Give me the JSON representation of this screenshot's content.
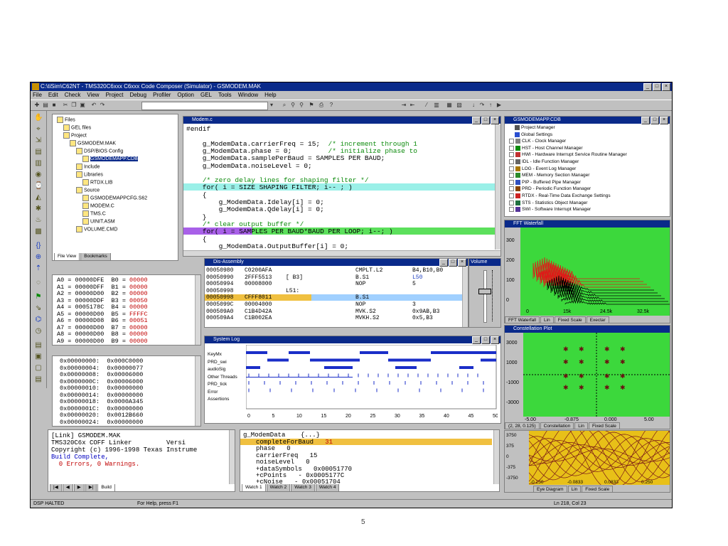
{
  "window": {
    "title": "C:\\tiSim\\C62NT - TMS320C6xxx C6xxx Code Composer (Simulator) - GSMODEM.MAK",
    "menu": [
      "File",
      "Edit",
      "Check",
      "View",
      "Project",
      "Debug",
      "Profiler",
      "Option",
      "GEL",
      "Tools",
      "Window",
      "Help"
    ]
  },
  "project_tree": {
    "items": [
      {
        "label": "Files",
        "level": 0
      },
      {
        "label": "GEL files",
        "level": 1
      },
      {
        "label": "Project",
        "level": 1
      },
      {
        "label": "GSMODEM.MAK",
        "level": 2
      },
      {
        "label": "DSP/BIOS Config",
        "level": 3
      },
      {
        "label": "GSMODEMAPP.CDB",
        "level": 4,
        "selected": true
      },
      {
        "label": "Include",
        "level": 3
      },
      {
        "label": "Libraries",
        "level": 3
      },
      {
        "label": "RTDX.LIB",
        "level": 4
      },
      {
        "label": "Source",
        "level": 3
      },
      {
        "label": "GSMODEMAPPCFG.S62",
        "level": 4
      },
      {
        "label": "MODEM.C",
        "level": 4
      },
      {
        "label": "TMS.C",
        "level": 4
      },
      {
        "label": "UINIT.ASM",
        "level": 4
      },
      {
        "label": "VOLUME.CMD",
        "level": 3
      }
    ],
    "tabs": [
      "File View",
      "Bookmarks"
    ]
  },
  "editor": {
    "title": "Modem.c",
    "lines": [
      {
        "text": "#endif",
        "style": "normal"
      },
      {
        "text": "",
        "style": "normal"
      },
      {
        "text": "    g_ModemData.carrierFreq = 15;  ",
        "comment": "/* increment through 1",
        "style": "normal"
      },
      {
        "text": "    g_ModemData.phase = 0;         ",
        "comment": "/* initialize phase to",
        "style": "normal"
      },
      {
        "text": "    g_ModemData.samplePerBaud = SAMPLES PER BAUD;",
        "style": "normal"
      },
      {
        "text": "    g_ModemData.noiseLevel = 0;",
        "style": "normal"
      },
      {
        "text": "",
        "style": "normal"
      },
      {
        "text": "    ",
        "comment": "/* zero delay lines for shaping filter */",
        "style": "normal"
      },
      {
        "text": "    for( i = SIZE SHAPING FILTER; i-- ; )",
        "style": "cyan"
      },
      {
        "text": "    {",
        "style": "normal"
      },
      {
        "text": "        g_ModemData.Idelay[i] = 0;",
        "style": "normal"
      },
      {
        "text": "        g_ModemData.Qdelay[i] = 0;",
        "style": "normal"
      },
      {
        "text": "    }",
        "style": "normal"
      },
      {
        "text": "    ",
        "comment": "/* clear output buffer */",
        "style": "normal"
      },
      {
        "text": "    for( i = SAMPLES PER BAUD*BAUD PER LOOP; i--; )",
        "style": "purple"
      },
      {
        "text": "    {",
        "style": "normal"
      },
      {
        "text": "        g_ModemData.OutputBuffer[i] = 0;",
        "style": "normal"
      }
    ]
  },
  "dsp_config": {
    "title": "GSMODEMAPP.CDB",
    "items": [
      "Project Manager",
      "Global Settings",
      "CLK - Clock Manager",
      "HST - Host Channel Manager",
      "HWI - Hardware Interrupt Service Routine Manager",
      "IDL - Idle Function Manager",
      "LOG - Event Log Manager",
      "MEM - Memory Section Manager",
      "PIP - Buffered Pipe Manager",
      "PRD - Periodic Function Manager",
      "RTDX - Real-Time Data Exchange Settings",
      "STS - Statistics Object Manager",
      "SWI - Software Interrupt Manager"
    ]
  },
  "registers": {
    "rows": [
      {
        "a": "A0",
        "av": "00000DFE",
        "b": "B0",
        "bv": "00000"
      },
      {
        "a": "A1",
        "av": "00000DFF",
        "b": "B1",
        "bv": "00000"
      },
      {
        "a": "A2",
        "av": "00000D00",
        "b": "B2",
        "bv": "00000"
      },
      {
        "a": "A3",
        "av": "00000DDF",
        "b": "B3",
        "bv": "00050"
      },
      {
        "a": "A4",
        "av": "0005178C",
        "b": "B4",
        "bv": "00000"
      },
      {
        "a": "A5",
        "av": "00000D00",
        "b": "B5",
        "bv": "FFFFC"
      },
      {
        "a": "A6",
        "av": "00000D08",
        "b": "B6",
        "bv": "00051"
      },
      {
        "a": "A7",
        "av": "00000D00",
        "b": "B7",
        "bv": "00000"
      },
      {
        "a": "A8",
        "av": "00000D00",
        "b": "B8",
        "bv": "00000"
      },
      {
        "a": "A9",
        "av": "00000D00",
        "b": "B9",
        "bv": "00000"
      }
    ]
  },
  "memory": {
    "rows": [
      {
        "addr": "0x00000000:",
        "val": "0x000C0000"
      },
      {
        "addr": "0x00000004:",
        "val": "0x00000077"
      },
      {
        "addr": "0x00000008:",
        "val": "0x00006000"
      },
      {
        "addr": "0x0000000C:",
        "val": "0x00006000"
      },
      {
        "addr": "0x00000010:",
        "val": "0x00000000"
      },
      {
        "addr": "0x00000014:",
        "val": "0x00000000"
      },
      {
        "addr": "0x00000018:",
        "val": "0x0000A345"
      },
      {
        "addr": "0x0000001C:",
        "val": "0x00000000"
      },
      {
        "addr": "0x00000020:",
        "val": "0x0012B660"
      },
      {
        "addr": "0x00000024:",
        "val": "0x00000000"
      }
    ]
  },
  "disassembly": {
    "title": "Dis-Assembly",
    "rows": [
      {
        "addr": "00050980",
        "hex": "C0200AFA",
        "mark": "",
        "op": "CMPLT.L2",
        "args": "B4,B10,B0"
      },
      {
        "addr": "00050990",
        "hex": "2FFF5513",
        "mark": "[ B3]",
        "op": "B.S1",
        "args": "L50"
      },
      {
        "addr": "00050994",
        "hex": "00008000",
        "mark": "",
        "op": "NOP",
        "args": "5"
      },
      {
        "addr": "00050998",
        "hex": "",
        "mark": "L51:",
        "op": "",
        "args": ""
      },
      {
        "addr": "00050998",
        "hex": "CFFF8011",
        "mark": "",
        "op": "B.S1",
        "args": "",
        "current": true
      },
      {
        "addr": "0005099C",
        "hex": "00004000",
        "mark": "",
        "op": "NOP",
        "args": "3"
      },
      {
        "addr": "000509A0",
        "hex": "C1B4D42A",
        "mark": "",
        "op": "MVK.S2",
        "args": "0x9AB,B3"
      },
      {
        "addr": "000509A4",
        "hex": "C1B002EA",
        "mark": "",
        "op": "MVKH.S2",
        "args": "0x5,B3"
      }
    ],
    "volume_label": "Volume"
  },
  "system_log": {
    "title": "System Log",
    "rows": [
      "KeyMx",
      "PRD_swi",
      "audioSig",
      "Other Threads",
      "PRD_tick",
      "Error",
      "Assertions"
    ],
    "x_ticks": [
      "0",
      "5",
      "10",
      "15",
      "20",
      "25",
      "30",
      "35",
      "40",
      "45",
      "50"
    ]
  },
  "fft": {
    "title": "FFT Waterfall",
    "y_ticks": [
      "300",
      "200",
      "100",
      "0"
    ],
    "x_ticks": [
      "0",
      "15k",
      "24.5k",
      "32.5k"
    ],
    "buttons": [
      "FFT Waterfall",
      "Lin",
      "Fixed Scale",
      "Exectar"
    ]
  },
  "constellation": {
    "title": "Constellation Plot",
    "y_ticks": [
      "3000",
      "1000",
      "-1000",
      "-3000"
    ],
    "x_ticks": [
      "-5.00",
      "-0.875",
      "0.000",
      "5.00"
    ],
    "readout": "(2, 28, 0.125)",
    "buttons": [
      "Constellation",
      "Lin",
      "Fixed Scale"
    ]
  },
  "eye": {
    "y_ticks": [
      "3750",
      "375",
      "0",
      "-375",
      "-3750"
    ],
    "x_ticks": [
      "-0.250",
      "-0.0833",
      "0.0833",
      "0.250"
    ],
    "buttons": [
      "Eye Diagram",
      "Lin",
      "Fixed Scale"
    ]
  },
  "build": {
    "lines": [
      {
        "text": "[Link] GSMODEM.MAK",
        "color": "#000"
      },
      {
        "text": "TMS320C6x COFF Linker         Versi",
        "color": "#000"
      },
      {
        "text": "Copyright (c) 1996-1998 Texas Instrume",
        "color": "#000"
      },
      {
        "text": "Build Complete,",
        "color": "#0000c0"
      },
      {
        "text": "  0 Errors, 0 Warnings.",
        "color": "#c00000"
      }
    ],
    "tab": "Build"
  },
  "watch": {
    "header": "g_ModemData    {...}",
    "rows": [
      {
        "name": "completeForBaud",
        "val": "31",
        "highlight": true
      },
      {
        "name": "phase",
        "val": "0"
      },
      {
        "name": "carrierFreq",
        "val": "15"
      },
      {
        "name": "noiseLevel",
        "val": "0"
      },
      {
        "name": "+dataSymbols",
        "val": "0x00051770"
      },
      {
        "name": "+cPoints",
        "val": "- 0x0005177C"
      },
      {
        "name": "+cNoise",
        "val": "- 0x00051704"
      }
    ],
    "tabs": [
      "Watch 1",
      "Watch 2",
      "Watch 3",
      "Watch 4"
    ]
  },
  "statusbar": {
    "left": "DSP HALTED",
    "help": "For Help, press F1",
    "position": "Ln 218, Col 23"
  },
  "page_number": "5"
}
